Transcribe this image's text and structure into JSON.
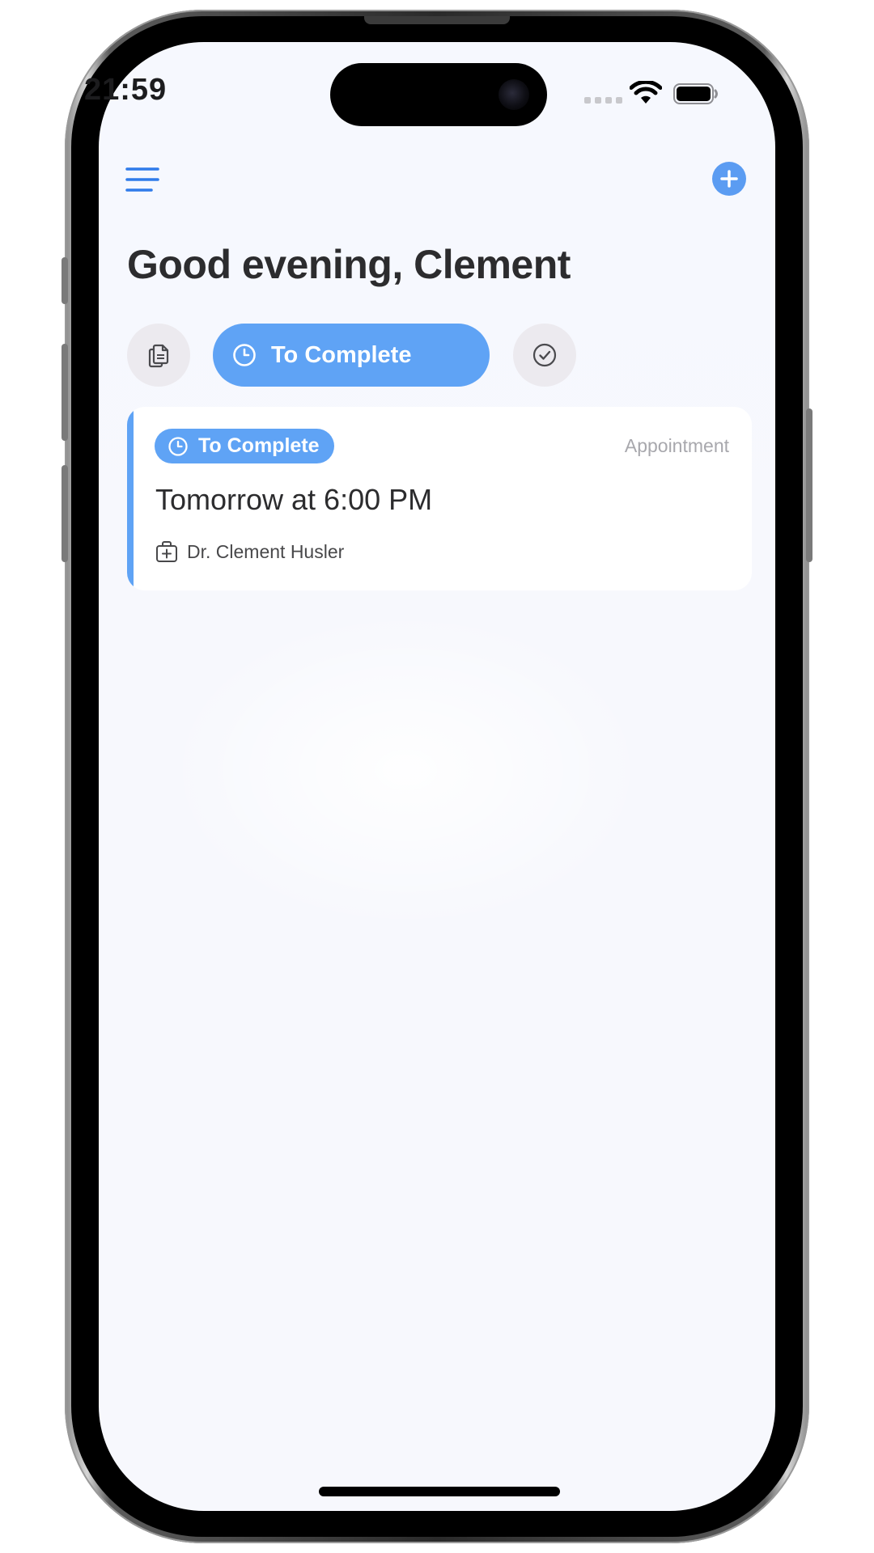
{
  "status_bar": {
    "time": "21:59",
    "icons": [
      "cellular-signal-icon",
      "wifi-icon",
      "battery-icon"
    ]
  },
  "header": {
    "menu_icon": "hamburger-menu-icon",
    "add_icon": "plus-icon",
    "greeting": "Good evening, Clement"
  },
  "filters": {
    "all_icon": "documents-icon",
    "active_label": "To Complete",
    "active_icon": "clock-icon",
    "done_icon": "checkmark-circle-icon"
  },
  "appointments": [
    {
      "status": "To Complete",
      "status_icon": "clock-icon",
      "type": "Appointment",
      "time": "Tomorrow at 6:00 PM",
      "doctor_icon": "medical-kit-icon",
      "doctor": "Dr. Clement Husler"
    }
  ],
  "colors": {
    "accent": "#5fa3f5",
    "button_blue": "#5b9cf2",
    "menu_blue": "#2f7bea",
    "chip_gray": "#eceaef",
    "text_dark": "#2c2c2e",
    "text_muted": "#a8a8ad",
    "screen_bg": "#f7f8fd"
  }
}
